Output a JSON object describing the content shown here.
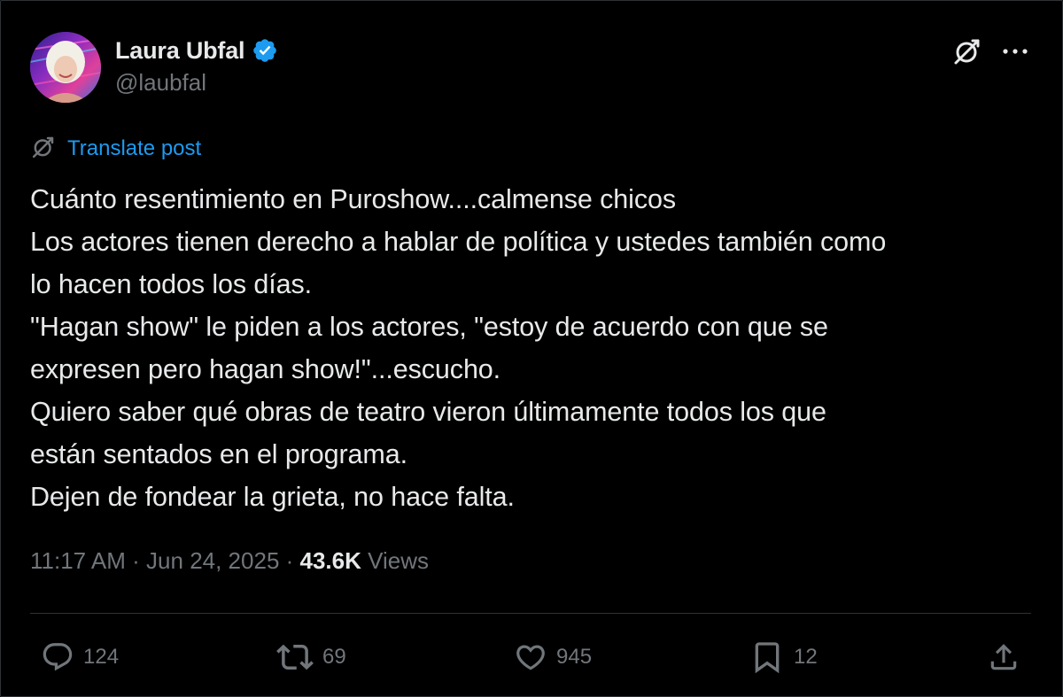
{
  "author": {
    "name": "Laura Ubfal",
    "handle": "@laubfal",
    "verified": true,
    "verified_color": "#1d9bf0"
  },
  "header": {
    "grok_icon": "grok-icon",
    "more_icon": "more-horizontal-icon"
  },
  "translate": {
    "label": "Translate post",
    "icon": "grok-icon"
  },
  "post": {
    "lines": [
      "Cuánto resentimiento en Puroshow....calmense chicos",
      "Los actores tienen derecho a hablar de política y ustedes también como",
      "lo hacen todos los días.",
      "\"Hagan show\" le piden a los actores, \"estoy de acuerdo con que se",
      "expresen pero hagan show!\"...escucho.",
      "Quiero saber qué obras de teatro vieron últimamente todos los que",
      "están sentados en el programa.",
      "Dejen de fondear la grieta, no hace falta."
    ]
  },
  "meta": {
    "time": "11:17 AM",
    "separator": " · ",
    "date": "Jun 24, 2025",
    "views_count": "43.6K",
    "views_label": " Views"
  },
  "actions": {
    "replies": "124",
    "reposts": "69",
    "likes": "945",
    "bookmarks": "12"
  },
  "colors": {
    "background": "#000000",
    "text": "#e7e9ea",
    "secondary": "#71767b",
    "accent": "#1d9bf0",
    "divider": "#2f3336"
  }
}
